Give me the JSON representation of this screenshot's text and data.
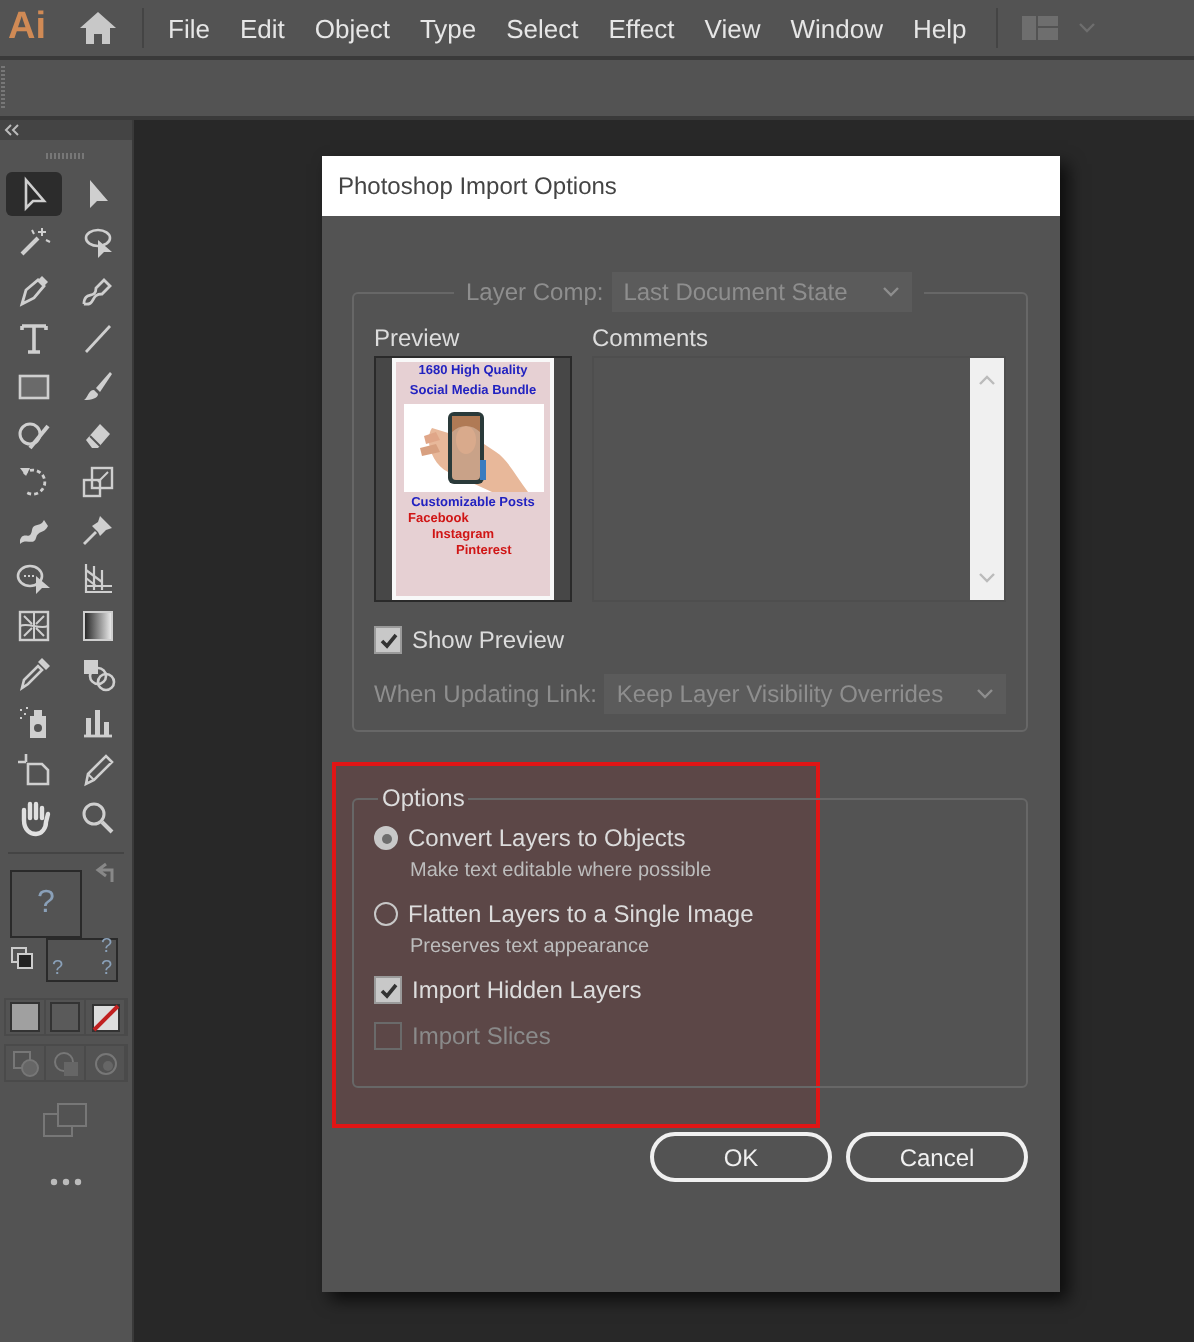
{
  "menu_bar": {
    "logo": "Ai",
    "items": [
      "File",
      "Edit",
      "Object",
      "Type",
      "Select",
      "Effect",
      "View",
      "Window",
      "Help"
    ]
  },
  "tools": [
    {
      "selected": true
    },
    {
      "selected": false
    },
    {
      "selected": false
    },
    {
      "selected": false
    },
    {
      "selected": false
    },
    {
      "selected": false
    },
    {
      "selected": false
    },
    {
      "selected": false
    },
    {
      "selected": false
    },
    {
      "selected": false
    },
    {
      "selected": false
    },
    {
      "selected": false
    },
    {
      "selected": false
    },
    {
      "selected": false
    },
    {
      "selected": false
    },
    {
      "selected": false
    },
    {
      "selected": false
    },
    {
      "selected": false
    },
    {
      "selected": false
    },
    {
      "selected": false
    },
    {
      "selected": false
    },
    {
      "selected": false
    },
    {
      "selected": false
    },
    {
      "selected": false
    },
    {
      "selected": false
    },
    {
      "selected": false
    },
    {
      "selected": false
    },
    {
      "selected": false
    }
  ],
  "fill_stroke": {
    "fill_mark": "?",
    "stroke_marks": [
      "?",
      "?",
      "?"
    ]
  },
  "dialog": {
    "title": "Photoshop Import Options",
    "layer_comp": {
      "label": "Layer Comp:",
      "value": "Last Document State",
      "disabled": true
    },
    "preview": {
      "label": "Preview",
      "headline": [
        "1680 High Quality",
        "Social Media Bundle"
      ],
      "subtitle": "Customizable Posts",
      "platforms": [
        "Facebook",
        "Instagram",
        "Pinterest"
      ]
    },
    "comments": {
      "label": "Comments"
    },
    "show_preview": {
      "label": "Show Preview",
      "checked": true
    },
    "updating_link": {
      "label": "When Updating Link:",
      "value": "Keep Layer Visibility Overrides",
      "disabled": true
    },
    "options": {
      "legend": "Options",
      "highlighted": true,
      "items": [
        {
          "kind": "radio",
          "label": "Convert Layers to Objects",
          "hint": "Make text editable where possible",
          "selected": true,
          "disabled": false
        },
        {
          "kind": "radio",
          "label": "Flatten Layers to a Single Image",
          "hint": "Preserves text appearance",
          "selected": false,
          "disabled": false
        },
        {
          "kind": "checkbox",
          "label": "Import Hidden Layers",
          "checked": true,
          "disabled": false
        },
        {
          "kind": "checkbox",
          "label": "Import Slices",
          "checked": false,
          "disabled": true
        }
      ]
    },
    "buttons": [
      "OK",
      "Cancel"
    ]
  }
}
